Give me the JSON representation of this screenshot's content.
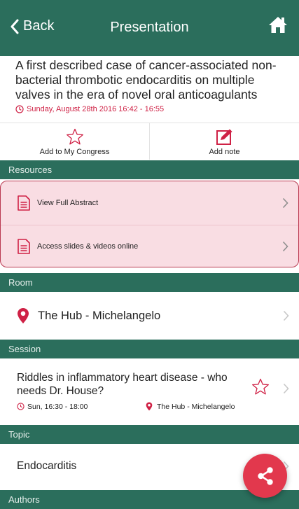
{
  "nav": {
    "back_label": "Back",
    "title": "Presentation"
  },
  "presentation": {
    "title": "A first described case of cancer-associated non-bacterial thrombotic endocarditis on multiple valves in the era of novel oral anticoagulants",
    "datetime": "Sunday, August 28th 2016 16:42 - 16:55"
  },
  "actions": {
    "add_to_congress": "Add to My Congress",
    "add_note": "Add note"
  },
  "sections": {
    "resources": "Resources",
    "room": "Room",
    "session": "Session",
    "topic": "Topic",
    "authors": "Authors"
  },
  "resources": {
    "items": [
      {
        "label": "View Full Abstract"
      },
      {
        "label": "Access slides & videos online"
      }
    ]
  },
  "room": {
    "name": "The Hub - Michelangelo"
  },
  "session": {
    "title": "Riddles in inflammatory heart disease - who needs Dr. House?",
    "time": "Sun, 16:30 - 18:00",
    "location": "The Hub - Michelangelo"
  },
  "topic": {
    "name": "Endocarditis"
  },
  "icons": {
    "back": "chevron-left-icon",
    "home": "home-icon",
    "clock": "clock-icon",
    "star": "star-outline-icon",
    "note": "edit-note-icon",
    "document": "document-icon",
    "pin": "map-pin-icon",
    "chevron": "chevron-right-icon",
    "share": "share-icon"
  },
  "colors": {
    "primary": "#2b6e5c",
    "accent": "#cf2145",
    "highlight_bg": "#f9dde3",
    "highlight_border": "#b9374f",
    "fab": "#e2384d"
  }
}
